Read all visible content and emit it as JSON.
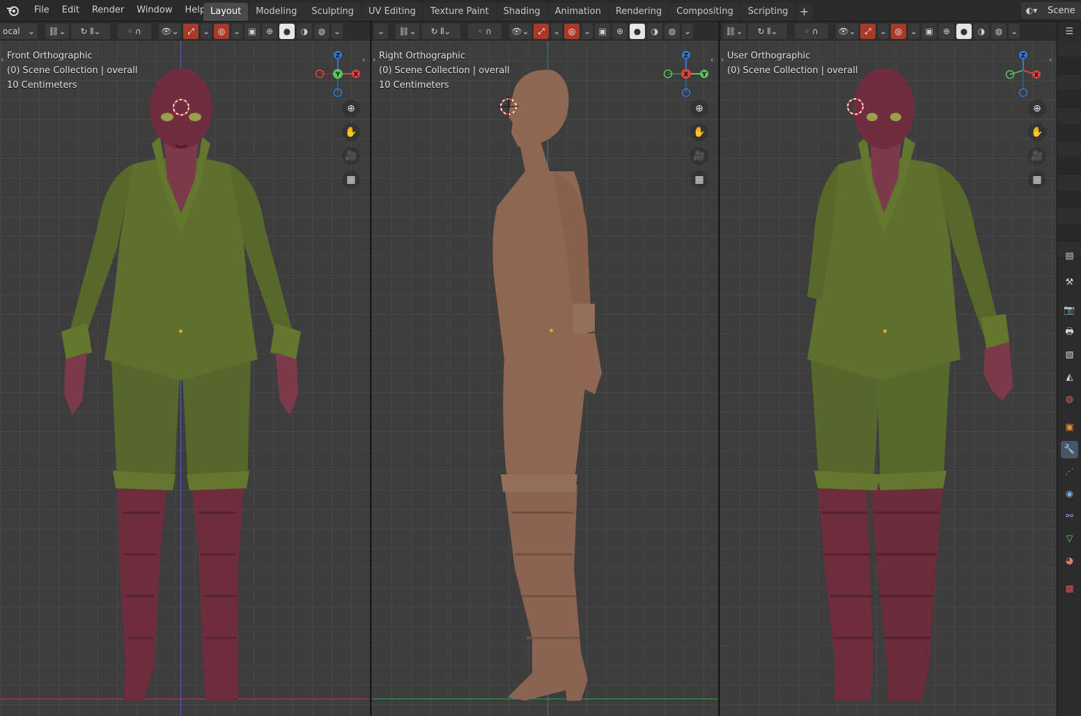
{
  "app": {
    "name": "Blender",
    "menu": [
      "File",
      "Edit",
      "Render",
      "Window",
      "Help"
    ],
    "workspace_tabs": [
      "Layout",
      "Modeling",
      "Sculpting",
      "UV Editing",
      "Texture Paint",
      "Shading",
      "Animation",
      "Rendering",
      "Compositing",
      "Scripting"
    ],
    "active_tab": "Layout",
    "add_tab_label": "+",
    "scene_label": "Scene"
  },
  "toolbar": {
    "pivot_dropdown": "ocal"
  },
  "viewports": [
    {
      "view_name": "Front Orthographic",
      "collection": "(0) Scene Collection | overall",
      "scale": "10 Centimeters",
      "gizmo_axes": [
        "Z",
        "Y",
        "X"
      ]
    },
    {
      "view_name": "Right Orthographic",
      "collection": "(0) Scene Collection | overall",
      "scale": "10 Centimeters",
      "gizmo_axes": [
        "Z",
        "X",
        "Y"
      ]
    },
    {
      "view_name": "User Orthographic",
      "collection": "(0) Scene Collection | overall",
      "gizmo_axes": [
        "Z",
        "X"
      ]
    }
  ],
  "colors": {
    "axis_x": "#e3413f",
    "axis_y": "#58c45a",
    "axis_z": "#2f79d4",
    "suit": "#596b2c",
    "skin": "#7a3a4a",
    "boots": "#6e2d3d",
    "clay": "#8c6650",
    "active_tab": "#4a4a4a",
    "viewport_bg": "#3d3d3d"
  },
  "icons": {
    "nav_buttons": [
      "zoom-icon",
      "pan-hand-icon",
      "camera-icon",
      "grid-icon"
    ],
    "properties_tabs": [
      "tool-icon",
      "render-icon",
      "output-icon",
      "view-layer-icon",
      "scene-icon",
      "world-icon",
      "object-icon",
      "modifier-icon",
      "particles-icon",
      "physics-icon",
      "constraints-icon",
      "data-icon",
      "material-icon",
      "texture-icon"
    ]
  }
}
